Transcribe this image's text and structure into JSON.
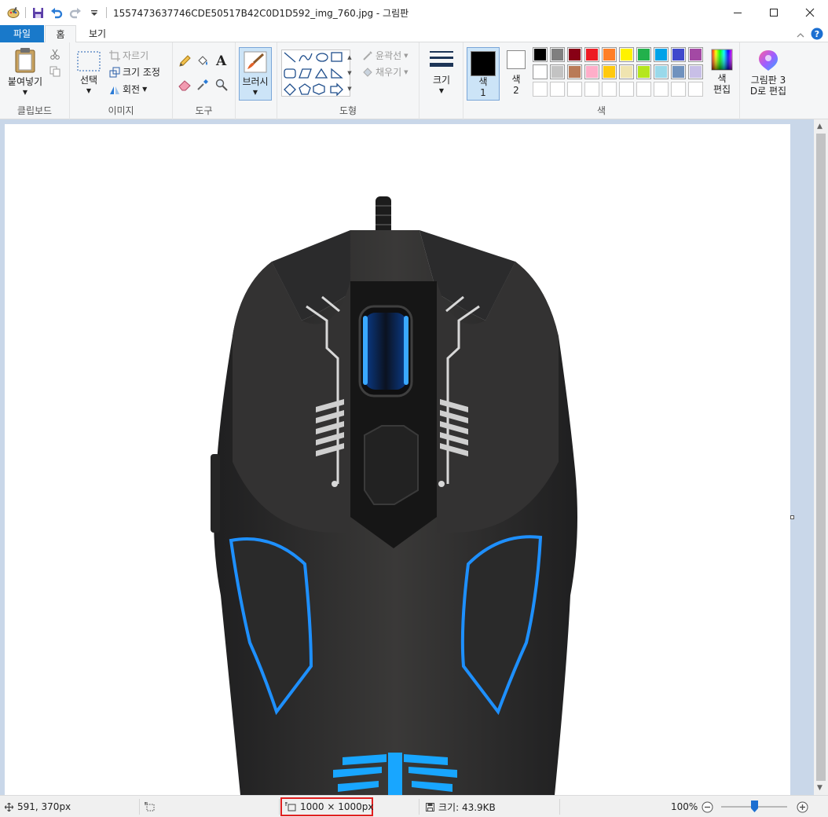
{
  "window": {
    "title": "1557473637746CDE50517B42C0D1D592_img_760.jpg - 그림판"
  },
  "tabs": {
    "file": "파일",
    "home": "홈",
    "view": "보기"
  },
  "ribbon": {
    "clipboard": {
      "label": "클립보드",
      "paste": "붙여넣기"
    },
    "image": {
      "label": "이미지",
      "select": "선택",
      "crop": "자르기",
      "resize": "크기 조정",
      "rotate": "회전"
    },
    "tools": {
      "label": "도구"
    },
    "brushes": {
      "label": "브러시"
    },
    "shapes": {
      "label": "도형",
      "outline": "윤곽선",
      "fill": "채우기"
    },
    "size": {
      "label": "크기"
    },
    "colors": {
      "label": "색",
      "color1_a": "색",
      "color1_b": "1",
      "color2_a": "색",
      "color2_b": "2",
      "edit_a": "색",
      "edit_b": "편집",
      "palette_row1": [
        "#000000",
        "#7f7f7f",
        "#880015",
        "#ed1c24",
        "#ff7f27",
        "#fff200",
        "#22b14c",
        "#00a2e8",
        "#3f48cc",
        "#a349a4"
      ],
      "palette_row2": [
        "#ffffff",
        "#c3c3c3",
        "#b97a57",
        "#ffaec9",
        "#ffc90e",
        "#efe4b0",
        "#b5e61d",
        "#99d9ea",
        "#7092be",
        "#c8bfe7"
      ],
      "primary": "#000000",
      "secondary": "#ffffff"
    },
    "paint3d": {
      "line1": "그림판 3",
      "line2": "D로 편집"
    }
  },
  "status": {
    "cursor": "591, 370px",
    "dimensions": "1000 × 1000px",
    "filesize": "크기: 43.9KB",
    "zoom": "100%"
  }
}
